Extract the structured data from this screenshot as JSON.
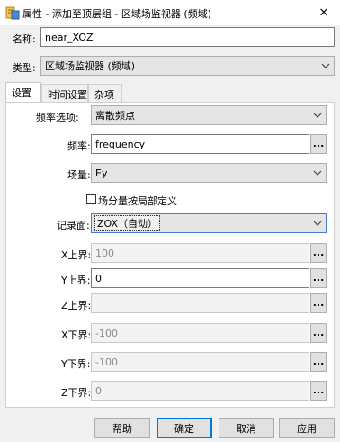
{
  "window": {
    "title": "属性 - 添加至顶层组 - 区域场监视器 (频域)",
    "close_symbol": "✕",
    "icon": "properties-icon"
  },
  "name_row": {
    "label": "名称:",
    "value": "near_XOZ"
  },
  "type_row": {
    "label": "类型:",
    "value": "区域场监视器 (频域)"
  },
  "tabs": [
    {
      "label": "设置",
      "active": true
    },
    {
      "label": "时间设置",
      "active": false
    },
    {
      "label": "杂项",
      "active": false
    }
  ],
  "settings": {
    "freq_option": {
      "label": "频率选项:",
      "value": "离散频点"
    },
    "frequency": {
      "label": "频率:",
      "value": "frequency",
      "browse": "..."
    },
    "field": {
      "label": "场量:",
      "value": "Ey"
    },
    "local_axes": {
      "label": "场分量按局部定义",
      "checked": false
    },
    "record_plane": {
      "label": "记录面:",
      "value": "ZOX（自动）"
    },
    "x_upper": {
      "label": "X上界:",
      "value": "100",
      "enabled": false,
      "browse": "..."
    },
    "y_upper": {
      "label": "Y上界:",
      "value": "0",
      "enabled": true,
      "browse": "..."
    },
    "z_upper": {
      "label": "Z上界:",
      "value": "",
      "enabled": false,
      "browse": "..."
    },
    "x_lower": {
      "label": "X下界:",
      "value": "-100",
      "enabled": false,
      "browse": "..."
    },
    "y_lower": {
      "label": "Y下界:",
      "value": "-100",
      "enabled": false,
      "browse": "..."
    },
    "z_lower": {
      "label": "Z下界:",
      "value": "0",
      "enabled": false,
      "browse": "..."
    }
  },
  "buttons": {
    "help": "帮助",
    "ok": "确定",
    "cancel": "取消",
    "apply": "应用"
  },
  "colors": {
    "accent": "#0078d7",
    "window_bg": "#f0f0f0"
  }
}
